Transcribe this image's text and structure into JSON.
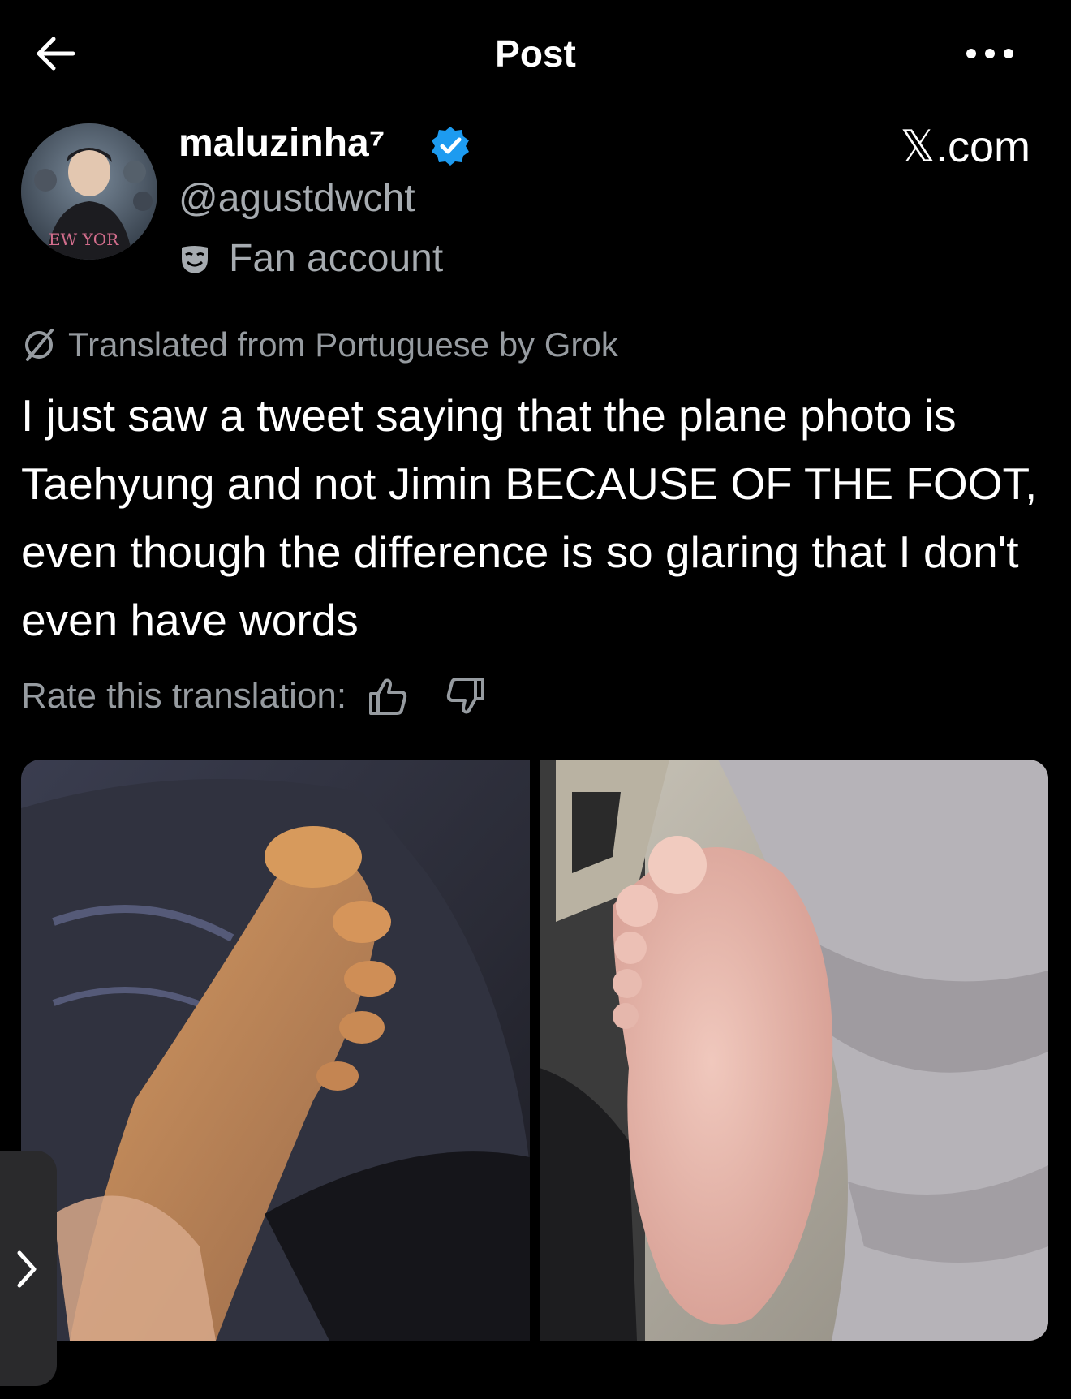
{
  "header": {
    "title": "Post",
    "back_icon": "arrow-left-icon",
    "more_icon": "more-horizontal-icon"
  },
  "author": {
    "display_name": "maluzinha⁷",
    "handle": "@agustdwcht",
    "affiliation": "Fan account",
    "affiliation_icon": "theater-masks-icon",
    "verified_icon": "verified-badge-icon"
  },
  "site_label": "𝕏.com",
  "translation": {
    "label": "Translated from Portuguese by Grok",
    "icon": "grok-slash-icon"
  },
  "post": {
    "text": "I just saw a tweet saying that the plane photo is Taehyung and not Jimin BECAUSE OF THE FOOT, even though the difference is so glaring that I don't even have words"
  },
  "rating": {
    "label": "Rate this translation:",
    "up_icon": "thumbs-up-icon",
    "down_icon": "thumbs-down-icon"
  },
  "colors": {
    "background": "#000000",
    "text_primary": "#ffffff",
    "text_secondary": "#a6abb0",
    "verified_blue": "#1d9bf0"
  }
}
